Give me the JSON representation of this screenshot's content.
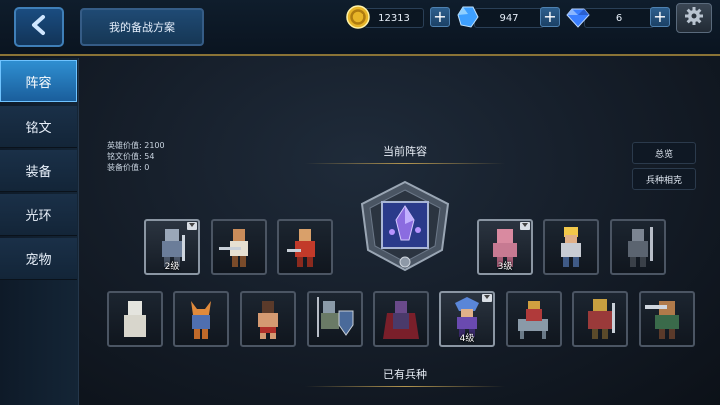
{
  "header": {
    "back_icon": "chevron-left-icon",
    "plan_label": "我的备战方案",
    "gold": "12313",
    "crystal": "947",
    "diamond": "6",
    "gold_icon": "gold-coin-icon",
    "crystal_icon": "blue-crystal-icon",
    "diamond_icon": "diamond-icon",
    "plus_label": "+",
    "settings_icon": "gear-icon"
  },
  "sidebar": {
    "items": [
      {
        "label": "阵容",
        "active": true
      },
      {
        "label": "铭文",
        "active": false
      },
      {
        "label": "装备",
        "active": false
      },
      {
        "label": "光环",
        "active": false
      },
      {
        "label": "宠物",
        "active": false
      }
    ]
  },
  "stats": {
    "hero_value": "英雄价值: 2100",
    "inscription_value": "铭文价值: 54",
    "equipment_value": "装备价值: 0"
  },
  "lineup": {
    "title": "当前阵容",
    "emblem_icon": "purple-crystal-shield-emblem",
    "overview_label": "总览",
    "counter_label": "兵种相克",
    "slots": [
      {
        "name": "knight-hero",
        "level": "2级",
        "owned": true
      },
      {
        "name": "swordsman-hero",
        "level": "",
        "owned": false
      },
      {
        "name": "red-warrior-hero",
        "level": "",
        "owned": false
      },
      {
        "name": "pink-brawler-hero",
        "level": "3级",
        "owned": true
      },
      {
        "name": "blonde-fighter-hero",
        "level": "",
        "owned": false
      },
      {
        "name": "armored-spearman-hero",
        "level": "",
        "owned": false
      }
    ]
  },
  "roster": {
    "title": "已有兵种",
    "units": [
      {
        "name": "white-robed-monk",
        "level": "",
        "owned": false
      },
      {
        "name": "fox-warrior",
        "level": "",
        "owned": false
      },
      {
        "name": "martial-artist",
        "level": "",
        "owned": false
      },
      {
        "name": "shield-spearman",
        "level": "",
        "owned": false
      },
      {
        "name": "caped-vampire",
        "level": "",
        "owned": false
      },
      {
        "name": "blue-haired-swordsman",
        "level": "4级",
        "owned": true
      },
      {
        "name": "mounted-knight",
        "level": "",
        "owned": false
      },
      {
        "name": "armored-commander",
        "level": "",
        "owned": false
      },
      {
        "name": "bear-greatsword",
        "level": "",
        "owned": false
      }
    ]
  },
  "colors": {
    "accent_blue": "#2f8fd1",
    "gold_divider": "#b3954f",
    "background": "#141c27"
  }
}
